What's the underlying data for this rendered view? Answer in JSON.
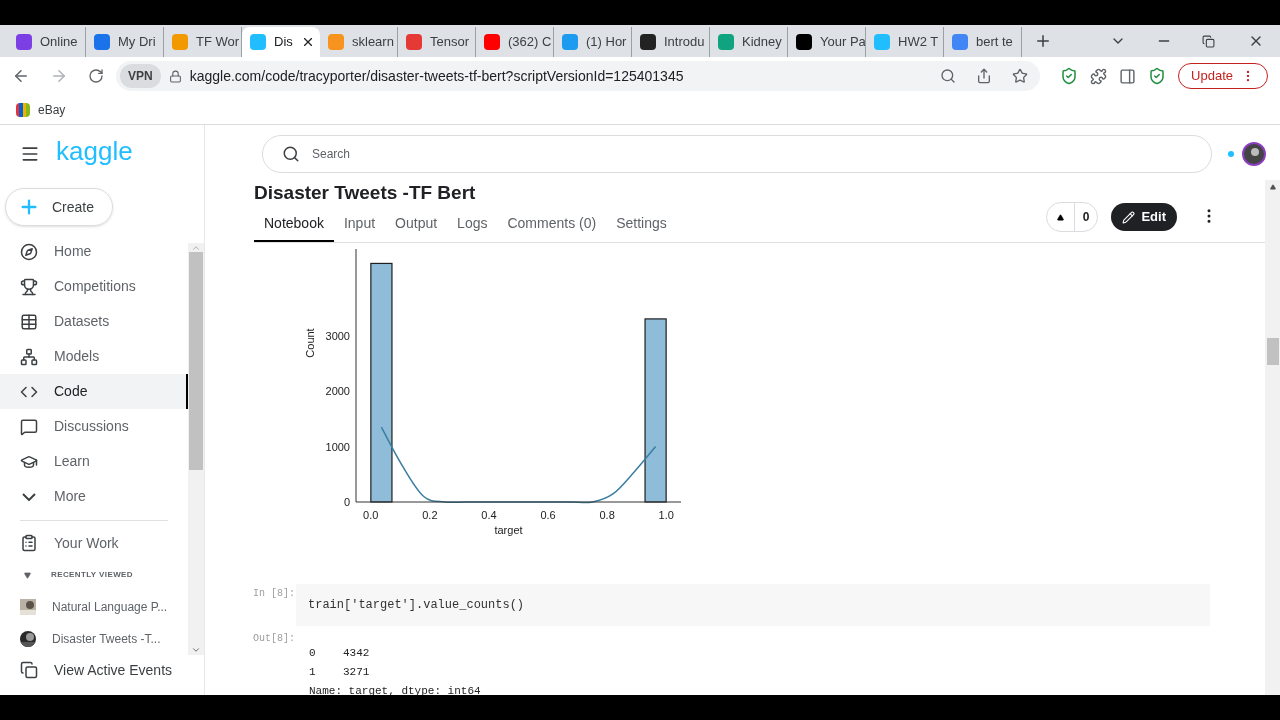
{
  "browser": {
    "tabs": [
      {
        "title": "Online",
        "selected": false
      },
      {
        "title": "My Dri",
        "selected": false
      },
      {
        "title": "TF Wor",
        "selected": false
      },
      {
        "title": "Dis",
        "selected": true
      },
      {
        "title": "sklearn",
        "selected": false
      },
      {
        "title": "Tensor",
        "selected": false
      },
      {
        "title": "(362) C",
        "selected": false
      },
      {
        "title": "(1) Hor",
        "selected": false
      },
      {
        "title": "Introdu",
        "selected": false
      },
      {
        "title": "Kidney",
        "selected": false
      },
      {
        "title": "Your Pa",
        "selected": false
      },
      {
        "title": "HW2 T",
        "selected": false
      },
      {
        "title": "bert te",
        "selected": false
      }
    ],
    "vpn_label": "VPN",
    "address": "kaggle.com/code/tracyporter/disaster-tweets-tf-bert?scriptVersionId=125401345",
    "update_button": "Update",
    "bookmarks": [
      "eBay"
    ]
  },
  "sidebar": {
    "brand": "kaggle",
    "create_button": "Create",
    "items": [
      {
        "label": "Home",
        "selected": false
      },
      {
        "label": "Competitions",
        "selected": false
      },
      {
        "label": "Datasets",
        "selected": false
      },
      {
        "label": "Models",
        "selected": false
      },
      {
        "label": "Code",
        "selected": true
      },
      {
        "label": "Discussions",
        "selected": false
      },
      {
        "label": "Learn",
        "selected": false
      },
      {
        "label": "More",
        "selected": false
      }
    ],
    "your_work": "Your Work",
    "recent_heading": "RECENTLY VIEWED",
    "recent": [
      "Natural Language P...",
      "Disaster Tweets -T..."
    ],
    "view_events": "View Active Events"
  },
  "search": {
    "placeholder": "Search"
  },
  "notebook": {
    "title": "Disaster Tweets -TF Bert",
    "tabs": [
      {
        "label": "Notebook",
        "selected": true
      },
      {
        "label": "Input",
        "selected": false
      },
      {
        "label": "Output",
        "selected": false
      },
      {
        "label": "Logs",
        "selected": false
      },
      {
        "label": "Comments (0)",
        "selected": false
      },
      {
        "label": "Settings",
        "selected": false
      }
    ],
    "votes": "0",
    "edit_button": "Edit"
  },
  "chart": {
    "chart_data": {
      "type": "bar",
      "xlabel": "target",
      "ylabel": "Count",
      "x": [
        0.036,
        0.107,
        0.179,
        0.25,
        0.321,
        0.393,
        0.464,
        0.536,
        0.607,
        0.679,
        0.75,
        0.821,
        0.893,
        0.964
      ],
      "series": [
        {
          "type": "bar",
          "color": "#8fbcd9",
          "values": [
            4300,
            null,
            null,
            null,
            null,
            null,
            null,
            null,
            null,
            null,
            null,
            null,
            null,
            3300
          ]
        },
        {
          "type": "line",
          "color": "#3b7ea1",
          "values": [
            1350,
            650,
            100,
            0,
            0,
            0,
            0,
            0,
            0,
            0,
            0,
            150,
            550,
            1000
          ]
        }
      ],
      "xlim": [
        -0.05,
        1.05
      ],
      "ylim": [
        0,
        4560
      ],
      "xticks": [
        {
          "value": 0,
          "label": "0.0"
        },
        {
          "value": 0.2,
          "label": "0.2"
        },
        {
          "value": 0.4,
          "label": "0.4"
        },
        {
          "value": 0.6,
          "label": "0.6"
        },
        {
          "value": 0.8,
          "label": "0.8"
        },
        {
          "value": 1,
          "label": "1.0"
        }
      ],
      "yticks": [
        0,
        1000,
        2000,
        3000
      ]
    }
  },
  "cell": {
    "prompt": "In [8]:",
    "code": "train['target'].value_counts()"
  },
  "output": {
    "prompt": "Out[8]:",
    "rows": [
      {
        "index": "0",
        "value": "4342"
      },
      {
        "index": "1",
        "value": "3271"
      }
    ],
    "footer": "Name: target, dtype: int64"
  }
}
